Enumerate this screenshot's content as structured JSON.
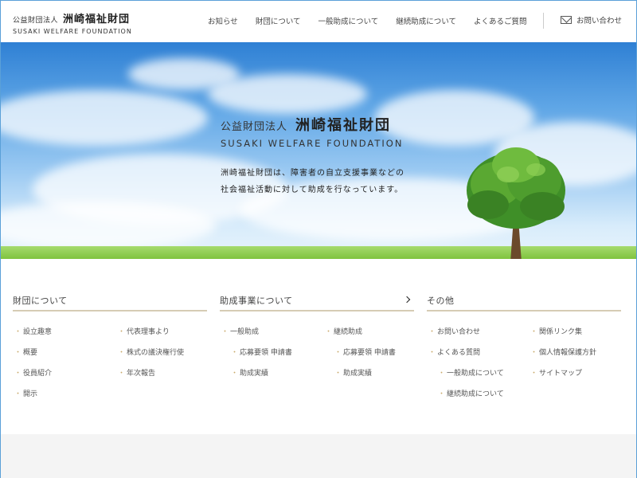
{
  "header": {
    "logo_corp": "公益財団法人",
    "logo_name": "洲崎福祉財団",
    "logo_en": "SUSAKI WELFARE FOUNDATION",
    "nav": [
      "お知らせ",
      "財団について",
      "一般助成について",
      "継続助成について",
      "よくあるご質問"
    ],
    "contact": "お問い合わせ"
  },
  "hero": {
    "corp": "公益財団法人",
    "name": "洲崎福祉財団",
    "en": "SUSAKI WELFARE FOUNDATION",
    "desc_line1": "洲崎福祉財団は、障害者の自立支援事業などの",
    "desc_line2": "社会福祉活動に対して助成を行なっています。"
  },
  "footer": {
    "col1": {
      "title": "財団について",
      "links": [
        "設立趣意",
        "概要",
        "役員紹介",
        "開示",
        "代表理事より",
        "株式の議決権行使",
        "年次報告"
      ]
    },
    "col2": {
      "title": "助成事業について",
      "links": [
        "一般助成",
        "応募要領 申請書",
        "助成実績",
        "継続助成",
        "応募要領 申請書",
        "助成実績"
      ]
    },
    "col3": {
      "title": "その他",
      "links": [
        "お問い合わせ",
        "よくある質問",
        "一般助成について",
        "継続助成について",
        "関係リンク集",
        "個人情報保護方針",
        "サイトマップ"
      ]
    }
  },
  "colors": {
    "accent_gold": "#c9a96a",
    "rule": "#d6ccb4",
    "sky": "#5fa6e6"
  }
}
